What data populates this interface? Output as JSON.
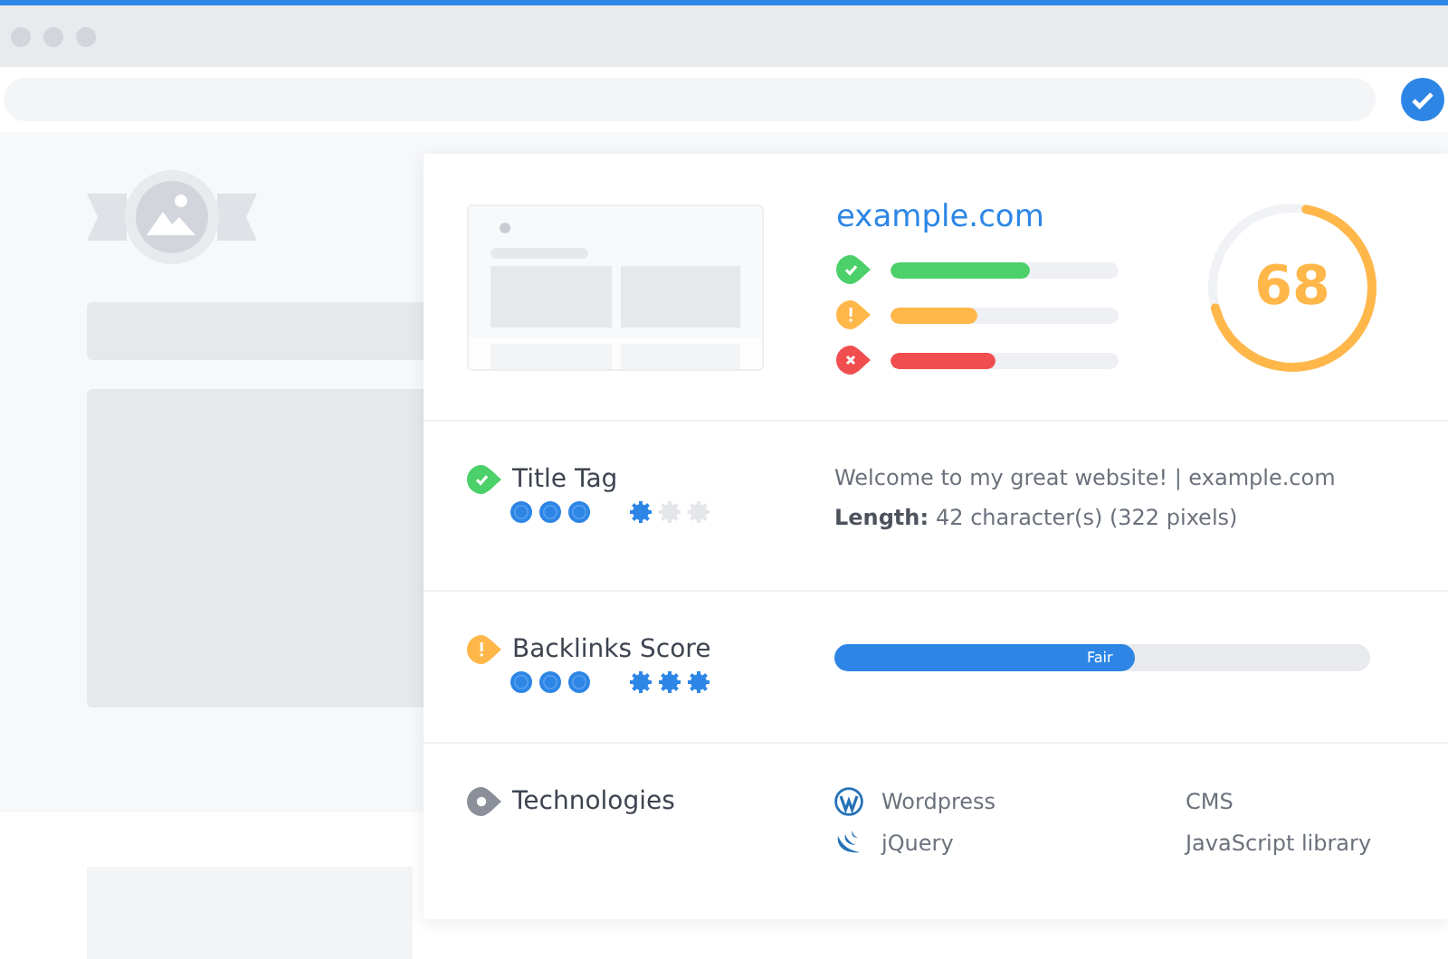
{
  "site": {
    "domain": "example.com"
  },
  "checks": [
    {
      "kind": "pass",
      "level": 0.61
    },
    {
      "kind": "warn",
      "level": 0.38
    },
    {
      "kind": "fail",
      "level": 0.46
    }
  ],
  "score": {
    "value": "68",
    "level": 0.68
  },
  "sections": [
    {
      "kind": "text",
      "status_icon": {
        "kind": "pass"
      },
      "title": "Title Tag",
      "impact": {
        "stars": 3
      },
      "effort": {
        "stars": 1
      },
      "text": "Welcome to my great website! | example.com",
      "length_label": "Length:",
      "length_value": "42 character(s) (322 pixels)"
    },
    {
      "kind": "bar",
      "status_icon": {
        "kind": "warn"
      },
      "title": "Backlinks Score",
      "impact": {
        "stars": 3
      },
      "effort": {
        "stars": 3
      },
      "level": 0.56,
      "bar_label": "Fair"
    },
    {
      "kind": "tech",
      "status_icon": {
        "kind": "info"
      },
      "title": "Technologies",
      "items": [
        {
          "kind": "wordpress",
          "name": "Wordpress",
          "category": "CMS"
        },
        {
          "kind": "jquery",
          "name": "jQuery",
          "category": "JavaScript library"
        }
      ]
    }
  ]
}
